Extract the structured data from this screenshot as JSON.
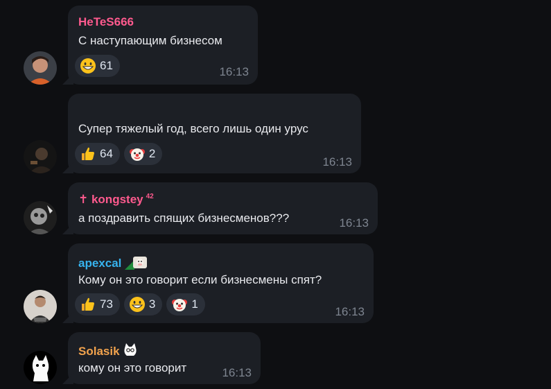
{
  "messages": [
    {
      "sender": "HeTeS666",
      "sender_color": "#ff5a8e",
      "text": "С наступающим бизнесом",
      "time": "16:13",
      "reactions": [
        {
          "emoji": "grinning-face-icon",
          "count": "61"
        }
      ]
    },
    {
      "sender": "",
      "text": "Супер тяжелый год, всего лишь один урус",
      "time": "16:13",
      "reactions": [
        {
          "emoji": "thumbs-up-icon",
          "count": "64"
        },
        {
          "emoji": "clown-face-icon",
          "count": "2"
        }
      ]
    },
    {
      "sender": "✝ kongstey",
      "sender_badge": "42",
      "sender_color": "#ff5a8e",
      "text": "а поздравить спящих бизнесменов???",
      "time": "16:13",
      "reactions": []
    },
    {
      "sender": "apexcal",
      "sender_color": "#37b3ee",
      "text": "Кому он это говорит если бизнесмены спят?",
      "time": "16:13",
      "reactions": [
        {
          "emoji": "thumbs-up-icon",
          "count": "73"
        },
        {
          "emoji": "grinning-face-icon",
          "count": "3"
        },
        {
          "emoji": "clown-face-icon",
          "count": "1"
        }
      ]
    },
    {
      "sender": "Solasik",
      "sender_color": "#f2a34d",
      "text": "кому он это говорит",
      "time": "16:13",
      "reactions": []
    }
  ]
}
